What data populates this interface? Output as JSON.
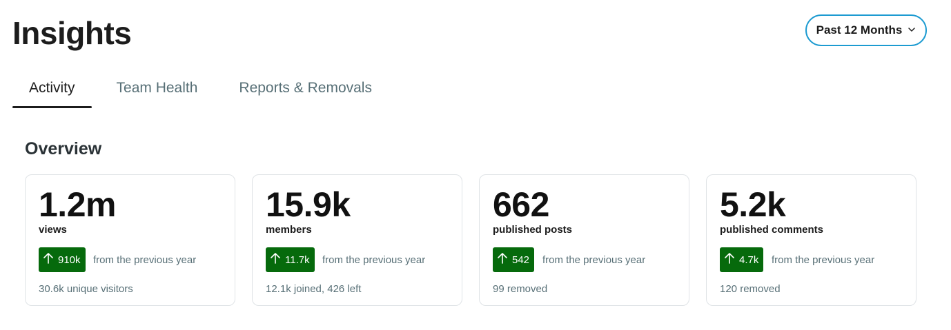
{
  "header": {
    "title": "Insights",
    "range_selector": {
      "selected": "Past 12 Months",
      "icon": "chevron-down-icon"
    }
  },
  "tabs": [
    {
      "label": "Activity",
      "active": true
    },
    {
      "label": "Team Health",
      "active": false
    },
    {
      "label": "Reports & Removals",
      "active": false
    }
  ],
  "overview": {
    "title": "Overview",
    "cards": [
      {
        "value": "1.2m",
        "metric": "views",
        "change": "910k",
        "comparison": "from the previous year",
        "footnote": "30.6k unique visitors"
      },
      {
        "value": "15.9k",
        "metric": "members",
        "change": "11.7k",
        "comparison": "from the previous year",
        "footnote": "12.1k joined, 426 left"
      },
      {
        "value": "662",
        "metric": "published posts",
        "change": "542",
        "comparison": "from the previous year",
        "footnote": "99 removed"
      },
      {
        "value": "5.2k",
        "metric": "published comments",
        "change": "4.7k",
        "comparison": "from the previous year",
        "footnote": "120 removed"
      }
    ]
  },
  "colors": {
    "accent_border": "#1d9bd1",
    "positive_badge": "#066a0c",
    "muted_text": "#576f76"
  }
}
